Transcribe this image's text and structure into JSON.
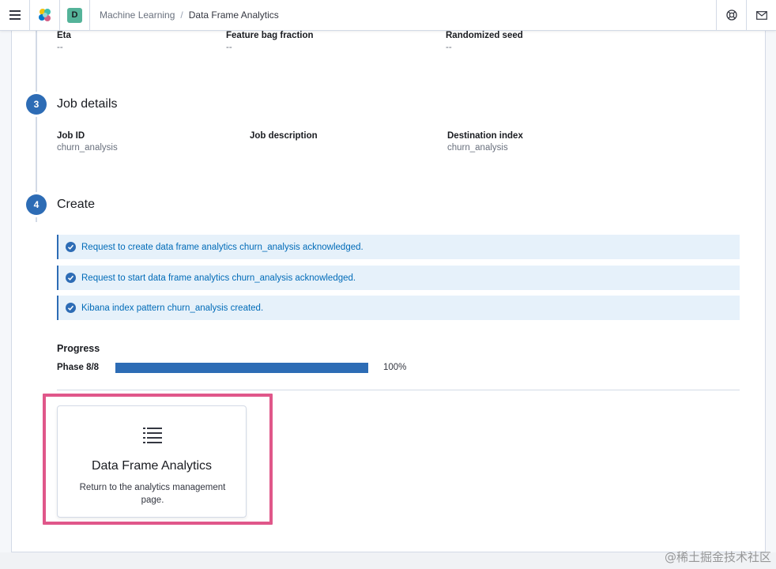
{
  "header": {
    "space_initial": "D",
    "breadcrumbs": [
      "Machine Learning",
      "Data Frame Analytics"
    ]
  },
  "hyperparameters": {
    "fields": [
      {
        "title": "Eta",
        "value": "--"
      },
      {
        "title": "Feature bag fraction",
        "value": "--"
      },
      {
        "title": "Randomized seed",
        "value": "--"
      }
    ]
  },
  "step3": {
    "number": "3",
    "title": "Job details",
    "fields": [
      {
        "title": "Job ID",
        "value": "churn_analysis"
      },
      {
        "title": "Job description",
        "value": ""
      },
      {
        "title": "Destination index",
        "value": "churn_analysis"
      }
    ]
  },
  "step4": {
    "number": "4",
    "title": "Create",
    "messages": [
      "Request to create data frame analytics churn_analysis acknowledged.",
      "Request to start data frame analytics churn_analysis acknowledged.",
      "Kibana index pattern churn_analysis created."
    ],
    "progress": {
      "title": "Progress",
      "phase": "Phase 8/8",
      "percent_label": "100%",
      "fraction": 1.0
    }
  },
  "card": {
    "icon": "list-icon",
    "title": "Data Frame Analytics",
    "description": "Return to the analytics management page."
  },
  "colors": {
    "accent": "#2d6cb5",
    "highlight": "#e0578a",
    "callout_bg": "#e6f1fa"
  },
  "watermark": "@稀土掘金技术社区"
}
